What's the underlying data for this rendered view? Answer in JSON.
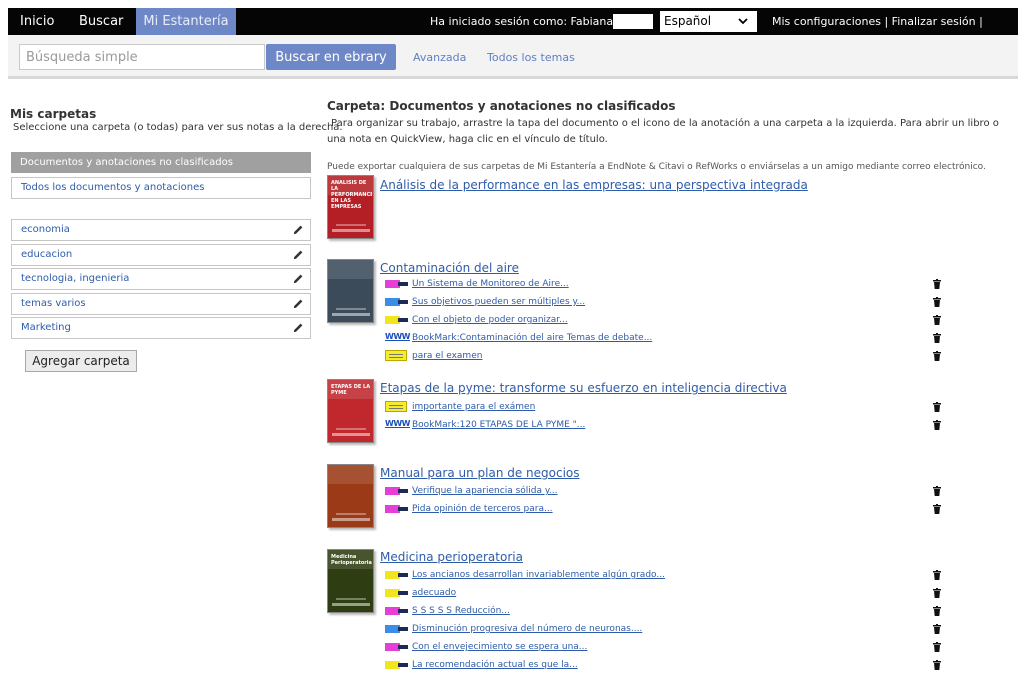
{
  "nav": {
    "tabs": [
      "Inicio",
      "Buscar",
      "Mi Estantería"
    ],
    "session_label": "Ha iniciado sesión como: Fabiana",
    "language": "Español",
    "user_links": "Mis configuraciones | Finalizar sesión | Ayuda"
  },
  "search": {
    "placeholder": "Búsqueda simple",
    "button": "Buscar en ebrary",
    "advanced": "Avanzada",
    "all_topics": "Todos los temas"
  },
  "sidebar": {
    "title": "Mis carpetas",
    "description": "Seleccione una carpeta (o todas) para ver sus notas a la derecha.",
    "active_folder": "Documentos y anotaciones no clasificados",
    "all_docs": "Todos los documentos y anotaciones",
    "folders": [
      "economia",
      "educacion",
      "tecnologia, ingenieria",
      "temas varios",
      "Marketing"
    ],
    "add_button": "Agregar carpeta"
  },
  "main": {
    "title": "Carpeta: Documentos y anotaciones no clasificados",
    "description": "Para organizar su trabajo, arrastre la tapa del documento o el icono de la anotación a una carpeta a la izquierda. Para abrir un libro o una nota en QuickView, haga clic en el vínculo de título.",
    "export_note": "Puede exportar cualquiera de sus carpetas de Mi Estantería a EndNote & Citavi o RefWorks o enviárselas a un amigo mediante correo electrónico.",
    "books": [
      {
        "title": "Análisis de la performance en las empresas: una perspectiva integrada",
        "cover_text": "ANÁLISIS DE LA PERFORMANCE EN LAS EMPRESAS",
        "cover_color": "#b31f24",
        "notes": []
      },
      {
        "title": "Contaminación del aire",
        "cover_text": "",
        "cover_color": "#3c4b5a",
        "notes": [
          {
            "type": "highlight",
            "color": "#e43fd6",
            "text": "Un Sistema de Monitoreo de Aire..."
          },
          {
            "type": "highlight",
            "color": "#3b8ee8",
            "text": "Sus objetivos pueden ser múltiples y..."
          },
          {
            "type": "highlight",
            "color": "#f2e41d",
            "text": "Con el objeto de poder organizar..."
          },
          {
            "type": "bookmark",
            "color": "#1c4fb8",
            "text": "BookMark:Contaminación del aire Temas de debate..."
          },
          {
            "type": "sticky",
            "color": "#f5ec2b",
            "text": "para el examen"
          }
        ]
      },
      {
        "title": "Etapas de la pyme: transforme su esfuerzo en inteligencia directiva",
        "cover_text": "ETAPAS DE LA PYME",
        "cover_color": "#c0282d",
        "notes": [
          {
            "type": "sticky",
            "color": "#f5ec2b",
            "text": "importante para el exámen"
          },
          {
            "type": "bookmark",
            "color": "#1c4fb8",
            "text": "BookMark:120 ETAPAS DE LA PYME \"..."
          }
        ]
      },
      {
        "title": "Manual para un plan de negocios",
        "cover_text": "",
        "cover_color": "#9a3a16",
        "notes": [
          {
            "type": "highlight",
            "color": "#e43fd6",
            "text": "Verifique la apariencia sólida y..."
          },
          {
            "type": "highlight",
            "color": "#e43fd6",
            "text": "Pida opinión de terceros para..."
          }
        ]
      },
      {
        "title": "Medicina perioperatoria",
        "cover_text": "Medicina Perioperatoria",
        "cover_color": "#2e3d12",
        "notes": [
          {
            "type": "highlight",
            "color": "#f2e41d",
            "text": "Los ancianos desarrollan invariablemente algún grado..."
          },
          {
            "type": "highlight",
            "color": "#f2e41d",
            "text": "adecuado"
          },
          {
            "type": "highlight",
            "color": "#e43fd6",
            "text": "S S S S S Reducción..."
          },
          {
            "type": "highlight",
            "color": "#3b8ee8",
            "text": "Disminución progresiva del número de neuronas...."
          },
          {
            "type": "highlight",
            "color": "#e43fd6",
            "text": "Con el envejecimiento se espera una..."
          },
          {
            "type": "highlight",
            "color": "#f2e41d",
            "text": "La recomendación actual es que la..."
          }
        ]
      }
    ]
  }
}
